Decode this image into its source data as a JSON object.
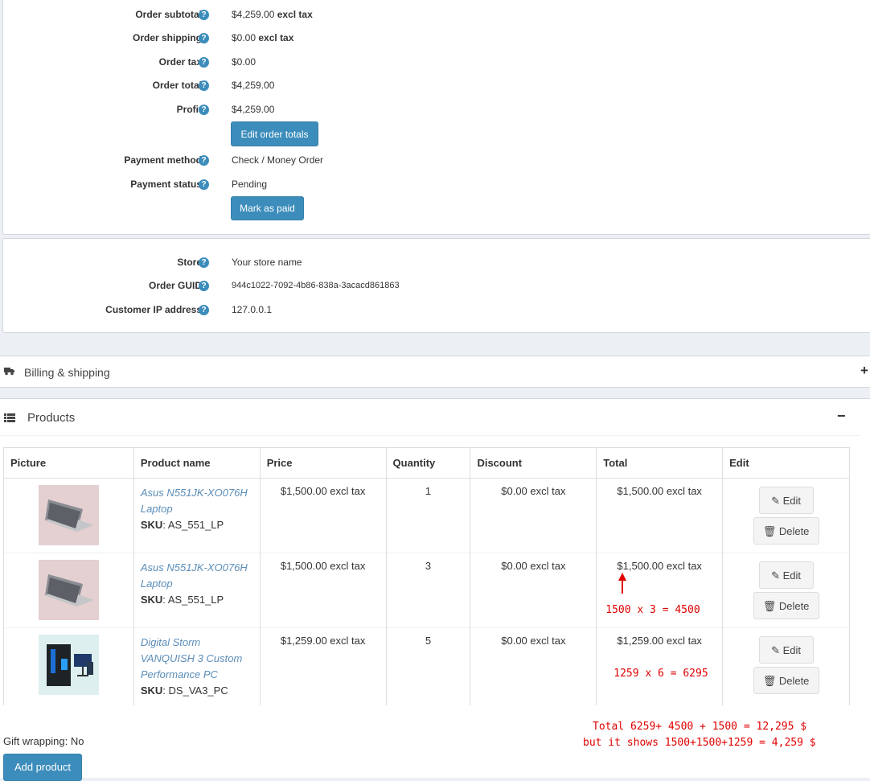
{
  "order_totals": {
    "rows": [
      {
        "label": "Order subtotal",
        "value": "$4,259.00",
        "suffix": "excl tax"
      },
      {
        "label": "Order shipping",
        "value": "$0.00",
        "suffix": "excl tax"
      },
      {
        "label": "Order tax",
        "value": "$0.00",
        "suffix": ""
      },
      {
        "label": "Order total",
        "value": "$4,259.00",
        "suffix": ""
      },
      {
        "label": "Profit",
        "value": "$4,259.00",
        "suffix": ""
      }
    ],
    "edit_button": "Edit order totals",
    "payment_method_label": "Payment method",
    "payment_method_value": "Check / Money Order",
    "payment_status_label": "Payment status",
    "payment_status_value": "Pending",
    "mark_paid_button": "Mark as paid"
  },
  "store_info": {
    "store_label": "Store",
    "store_value": "Your store name",
    "guid_label": "Order GUID",
    "guid_value": "944c1022-7092-4b86-838a-3acacd861863",
    "ip_label": "Customer IP address",
    "ip_value": "127.0.0.1"
  },
  "billing": {
    "title": "Billing & shipping",
    "toggle": "+"
  },
  "products": {
    "title": "Products",
    "toggle": "−",
    "columns": [
      "Picture",
      "Product name",
      "Price",
      "Quantity",
      "Discount",
      "Total",
      "Edit"
    ],
    "sku_label": "SKU",
    "rows": [
      {
        "name": "Asus N551JK-XO076H Laptop",
        "sku": "AS_551_LP",
        "price": "$1,500.00 excl tax",
        "qty": "1",
        "discount": "$0.00 excl tax",
        "total": "$1,500.00 excl tax",
        "image": "laptop"
      },
      {
        "name": "Asus N551JK-XO076H Laptop",
        "sku": "AS_551_LP",
        "price": "$1,500.00 excl tax",
        "qty": "3",
        "discount": "$0.00 excl tax",
        "total": "$1,500.00 excl tax",
        "image": "laptop"
      },
      {
        "name": "Digital Storm VANQUISH 3 Custom Performance PC",
        "sku": "DS_VA3_PC",
        "price": "$1,259.00 excl tax",
        "qty": "5",
        "discount": "$0.00 excl tax",
        "total": "$1,259.00 excl tax",
        "image": "desktop-pc"
      }
    ],
    "edit_button": "Edit",
    "delete_button": "Delete",
    "gift_wrapping": "Gift wrapping: No",
    "add_product_button": "Add product"
  },
  "annotations": {
    "row2": "1500 x 3 = 4500",
    "row3": "1259 x 6 = 6295",
    "total_line1": "Total 6259+ 4500 + 1500 = 12,295 $",
    "total_line2": "but it shows 1500+1500+1259 = 4,259 $"
  },
  "colors": {
    "primary": "#3c8dbc",
    "annotation": "#e00000",
    "link": "#5b8db8"
  }
}
